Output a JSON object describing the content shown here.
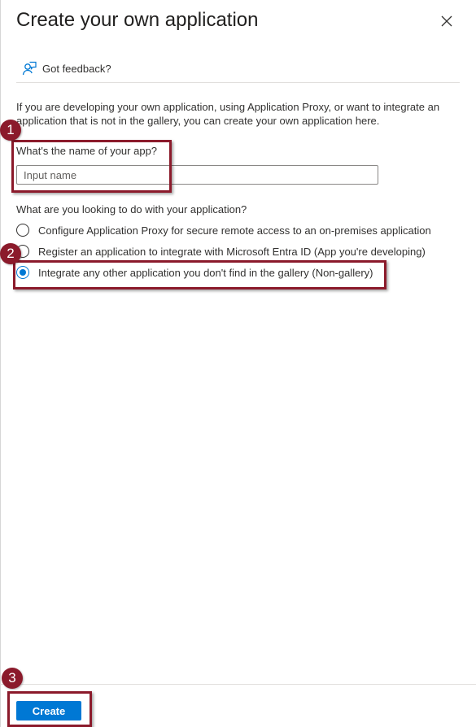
{
  "panel": {
    "title": "Create your own application",
    "close_icon": "close-icon"
  },
  "feedback": {
    "label": "Got feedback?",
    "icon": "feedback-icon"
  },
  "intro_text": "If you are developing your own application, using Application Proxy, or want to integrate an application that is not in the gallery, you can create your own application here.",
  "app_name": {
    "label": "What's the name of your app?",
    "placeholder": "Input name",
    "value": ""
  },
  "purpose": {
    "question": "What are you looking to do with your application?",
    "options": [
      {
        "label": "Configure Application Proxy for secure remote access to an on-premises application",
        "selected": false
      },
      {
        "label": "Register an application to integrate with Microsoft Entra ID (App you're developing)",
        "selected": false
      },
      {
        "label": "Integrate any other application you don't find in the gallery (Non-gallery)",
        "selected": true
      }
    ]
  },
  "footer": {
    "create_label": "Create"
  },
  "annotations": {
    "step1": "1",
    "step2": "2",
    "step3": "3"
  },
  "colors": {
    "accent": "#0078d4",
    "annotation": "#8b1a2b"
  }
}
